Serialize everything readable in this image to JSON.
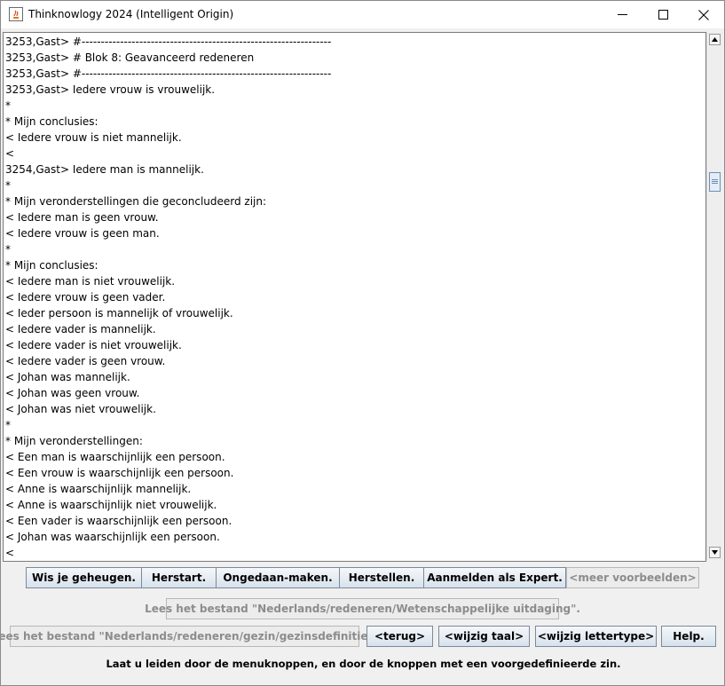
{
  "window": {
    "title": "Thinknowlogy 2024 (Intelligent Origin)",
    "controls": [
      "minimize-icon",
      "maximize-icon",
      "close-icon"
    ]
  },
  "output_lines": [
    "3253,Gast> #-----------------------------------------------------------------",
    "3253,Gast> # Blok 8: Geavanceerd redeneren",
    "3253,Gast> #-----------------------------------------------------------------",
    "3253,Gast> Iedere vrouw is vrouwelijk.",
    "*",
    "* Mijn conclusies:",
    "< Iedere vrouw is niet mannelijk.",
    "<",
    "3254,Gast> Iedere man is mannelijk.",
    "*",
    "* Mijn veronderstellingen die geconcludeerd zijn:",
    "< Iedere man is geen vrouw.",
    "< Iedere vrouw is geen man.",
    "*",
    "* Mijn conclusies:",
    "< Iedere man is niet vrouwelijk.",
    "< Iedere vrouw is geen vader.",
    "< Ieder persoon is mannelijk of vrouwelijk.",
    "< Iedere vader is mannelijk.",
    "< Iedere vader is niet vrouwelijk.",
    "< Iedere vader is geen vrouw.",
    "< Johan was mannelijk.",
    "< Johan was geen vrouw.",
    "< Johan was niet vrouwelijk.",
    "*",
    "* Mijn veronderstellingen:",
    "< Een man is waarschijnlijk een persoon.",
    "< Een vrouw is waarschijnlijk een persoon.",
    "< Anne is waarschijnlijk mannelijk.",
    "< Anne is waarschijnlijk niet vrouwelijk.",
    "< Een vader is waarschijnlijk een persoon.",
    "< Johan was waarschijnlijk een persoon.",
    "<"
  ],
  "buttons": {
    "row1": {
      "clear_memory": "Wis je geheugen.",
      "restart": "Herstart.",
      "undo": "Ongedaan-maken.",
      "redo": "Herstellen.",
      "login_expert": "Aanmelden als Expert.",
      "more_examples": "<meer voorbeelden>"
    },
    "row2": {
      "read_scientific": "Lees het bestand \"Nederlands/redeneren/Wetenschappelijke uitdaging\"."
    },
    "row3": {
      "read_family": "Lees het bestand \"Nederlands/redeneren/gezin/gezinsdefinitie\".",
      "back": "<terug>",
      "change_language": "<wijzig taal>",
      "change_font": "<wijzig lettertype>",
      "help": "Help."
    }
  },
  "status_text": "Laat u leiden door de menuknoppen, en door de knoppen met een voorgedefinieerde zin."
}
